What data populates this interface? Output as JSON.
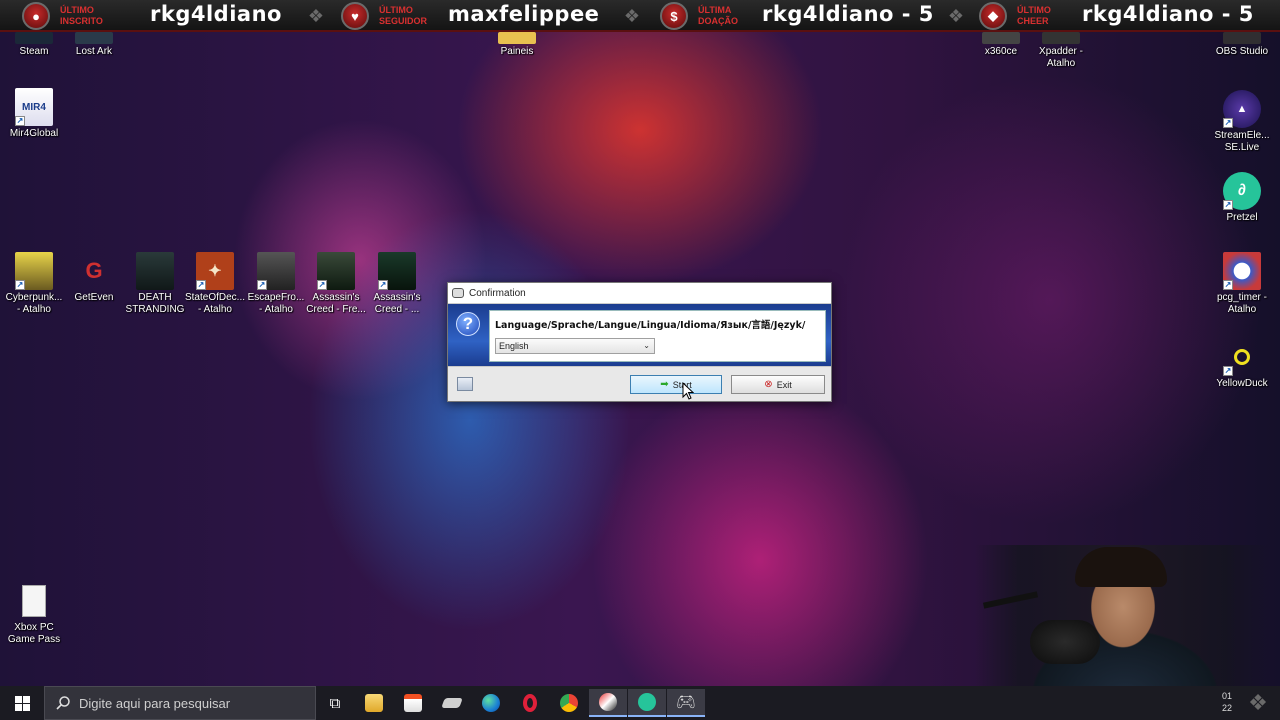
{
  "overlay": {
    "items": [
      {
        "label": "Último inscrito",
        "value": "rkg4ldiano",
        "icon": "user-icon",
        "glyph": "●"
      },
      {
        "label": "Último seguidor",
        "value": "maxfelippee",
        "icon": "heart-icon",
        "glyph": "♥"
      },
      {
        "label": "Última doação",
        "value": "rkg4ldiano - 5",
        "icon": "dollar-icon",
        "glyph": "$"
      },
      {
        "label": "Último cheer",
        "value": "rkg4ldiano - 5",
        "icon": "gem-icon",
        "glyph": "◆"
      }
    ],
    "accent_color": "#d93030"
  },
  "desktop_icons": {
    "steam": "Steam",
    "lost_ark": "Lost Ark",
    "paineis": "Paineis",
    "x360ce": "x360ce",
    "xpadder": "Xpadder - Atalho",
    "obs": "OBS Studio",
    "mir4": "Mir4Global",
    "streamelements": "StreamEle... SE.Live",
    "pretzel": "Pretzel",
    "cyberpunk": "Cyberpunk... - Atalho",
    "geteven": "GetEven",
    "death_stranding": "DEATH STRANDING",
    "stateofdecay": "StateOfDec... - Atalho",
    "escapefrom": "EscapeFro... - Atalho",
    "assassins1": "Assassin's Creed - Fre...",
    "assassins2": "Assassin's Creed - ...",
    "pcg_timer": "pcg_timer - Atalho",
    "yellowduck": "YellowDuck",
    "xbox": "Xbox PC Game Pass"
  },
  "dialog": {
    "title": "Confirmation",
    "prompt": "Language/Sprache/Langue/Lingua/Idioma/Язык/言語/Język/",
    "selected_language": "English",
    "start_label": "Start",
    "exit_label": "Exit"
  },
  "taskbar": {
    "search_placeholder": "Digite aqui para pesquisar",
    "apps": [
      "task-view-icon",
      "file-explorer-icon",
      "store-icon",
      "app-icon",
      "edge-icon",
      "opera-icon",
      "chrome-icon",
      "game-icon",
      "pretzel-icon",
      "controller-icon"
    ],
    "clock_partial": "01",
    "date_partial": "22"
  }
}
